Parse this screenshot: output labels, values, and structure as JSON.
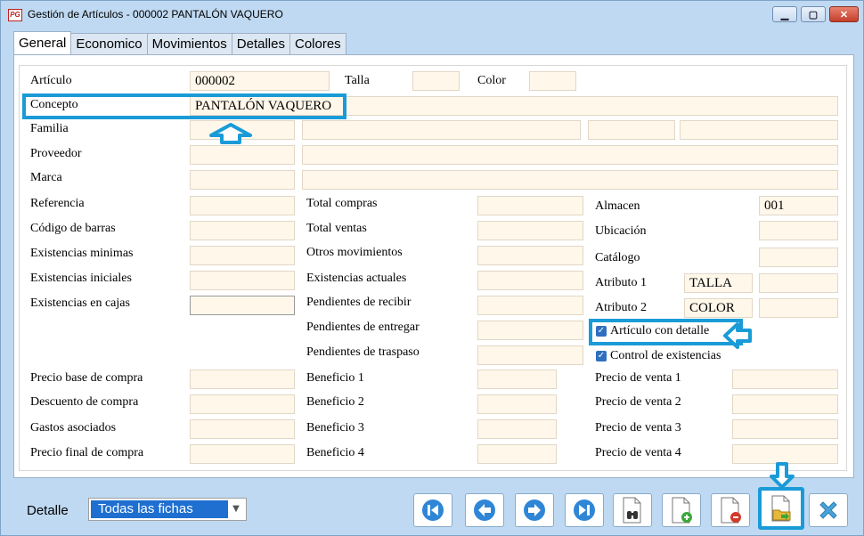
{
  "window": {
    "logo_text": "PG",
    "title": "Gestión de Artículos - 000002 PANTALÓN VAQUERO",
    "minimize_glyph": "▁",
    "maximize_glyph": "▢",
    "close_glyph": "✕"
  },
  "tabs": [
    "General",
    "Economico",
    "Movimientos",
    "Detalles",
    "Colores"
  ],
  "header": {
    "articulo_label": "Artículo",
    "articulo_value": "000002",
    "talla_label": "Talla",
    "talla_value": "",
    "color_label": "Color",
    "color_value": "",
    "concepto_label": "Concepto",
    "concepto_value": "PANTALÓN VAQUERO",
    "familia_label": "Familia",
    "proveedor_label": "Proveedor",
    "marca_label": "Marca"
  },
  "col1": {
    "referencia": "Referencia",
    "codigo_barras": "Código de barras",
    "existencias_minimas": "Existencias minimas",
    "existencias_iniciales": "Existencias iniciales",
    "existencias_cajas": "Existencias en cajas"
  },
  "col2": {
    "total_compras": "Total compras",
    "total_ventas": "Total ventas",
    "otros_movimientos": "Otros movimientos",
    "existencias_actuales": "Existencias actuales",
    "pendientes_recibir": "Pendientes de recibir",
    "pendientes_entregar": "Pendientes de entregar",
    "pendientes_traspaso": "Pendientes de traspaso"
  },
  "col3": {
    "almacen_label": "Almacen",
    "almacen_value": "001",
    "ubicacion_label": "Ubicación",
    "catalogo_label": "Catálogo",
    "atributo1_label": "Atributo 1",
    "atributo1_value": "TALLA",
    "atributo2_label": "Atributo 2",
    "atributo2_value": "COLOR",
    "articulo_detalle_label": "Artículo con detalle",
    "articulo_detalle_checked": true,
    "control_existencias_label": "Control de existencias",
    "control_existencias_checked": true
  },
  "prices": {
    "precio_base_compra": "Precio base de compra",
    "descuento_compra": "Descuento de compra",
    "gastos_asociados": "Gastos asociados",
    "precio_final_compra": "Precio final de compra",
    "beneficio1": "Beneficio 1",
    "beneficio2": "Beneficio 2",
    "beneficio3": "Beneficio 3",
    "beneficio4": "Beneficio 4",
    "precio_venta1": "Precio de venta 1",
    "precio_venta2": "Precio de venta 2",
    "precio_venta3": "Precio de venta 3",
    "precio_venta4": "Precio de venta 4"
  },
  "bottom": {
    "detalle_label": "Detalle",
    "detalle_value": "Todas las fichas"
  },
  "colors": {
    "accent": "#1a9bd7",
    "nav_blue": "#2f86d6",
    "field_bg": "#fff7ea",
    "window_bg": "#bfd9f2"
  },
  "icons": {
    "first": "first-record-icon",
    "prev": "previous-record-icon",
    "next": "next-record-icon",
    "last": "last-record-icon",
    "search": "binoculars-search-icon",
    "new": "new-document-icon",
    "delete": "delete-document-icon",
    "open": "open-folder-icon",
    "cancel": "cancel-x-icon"
  }
}
